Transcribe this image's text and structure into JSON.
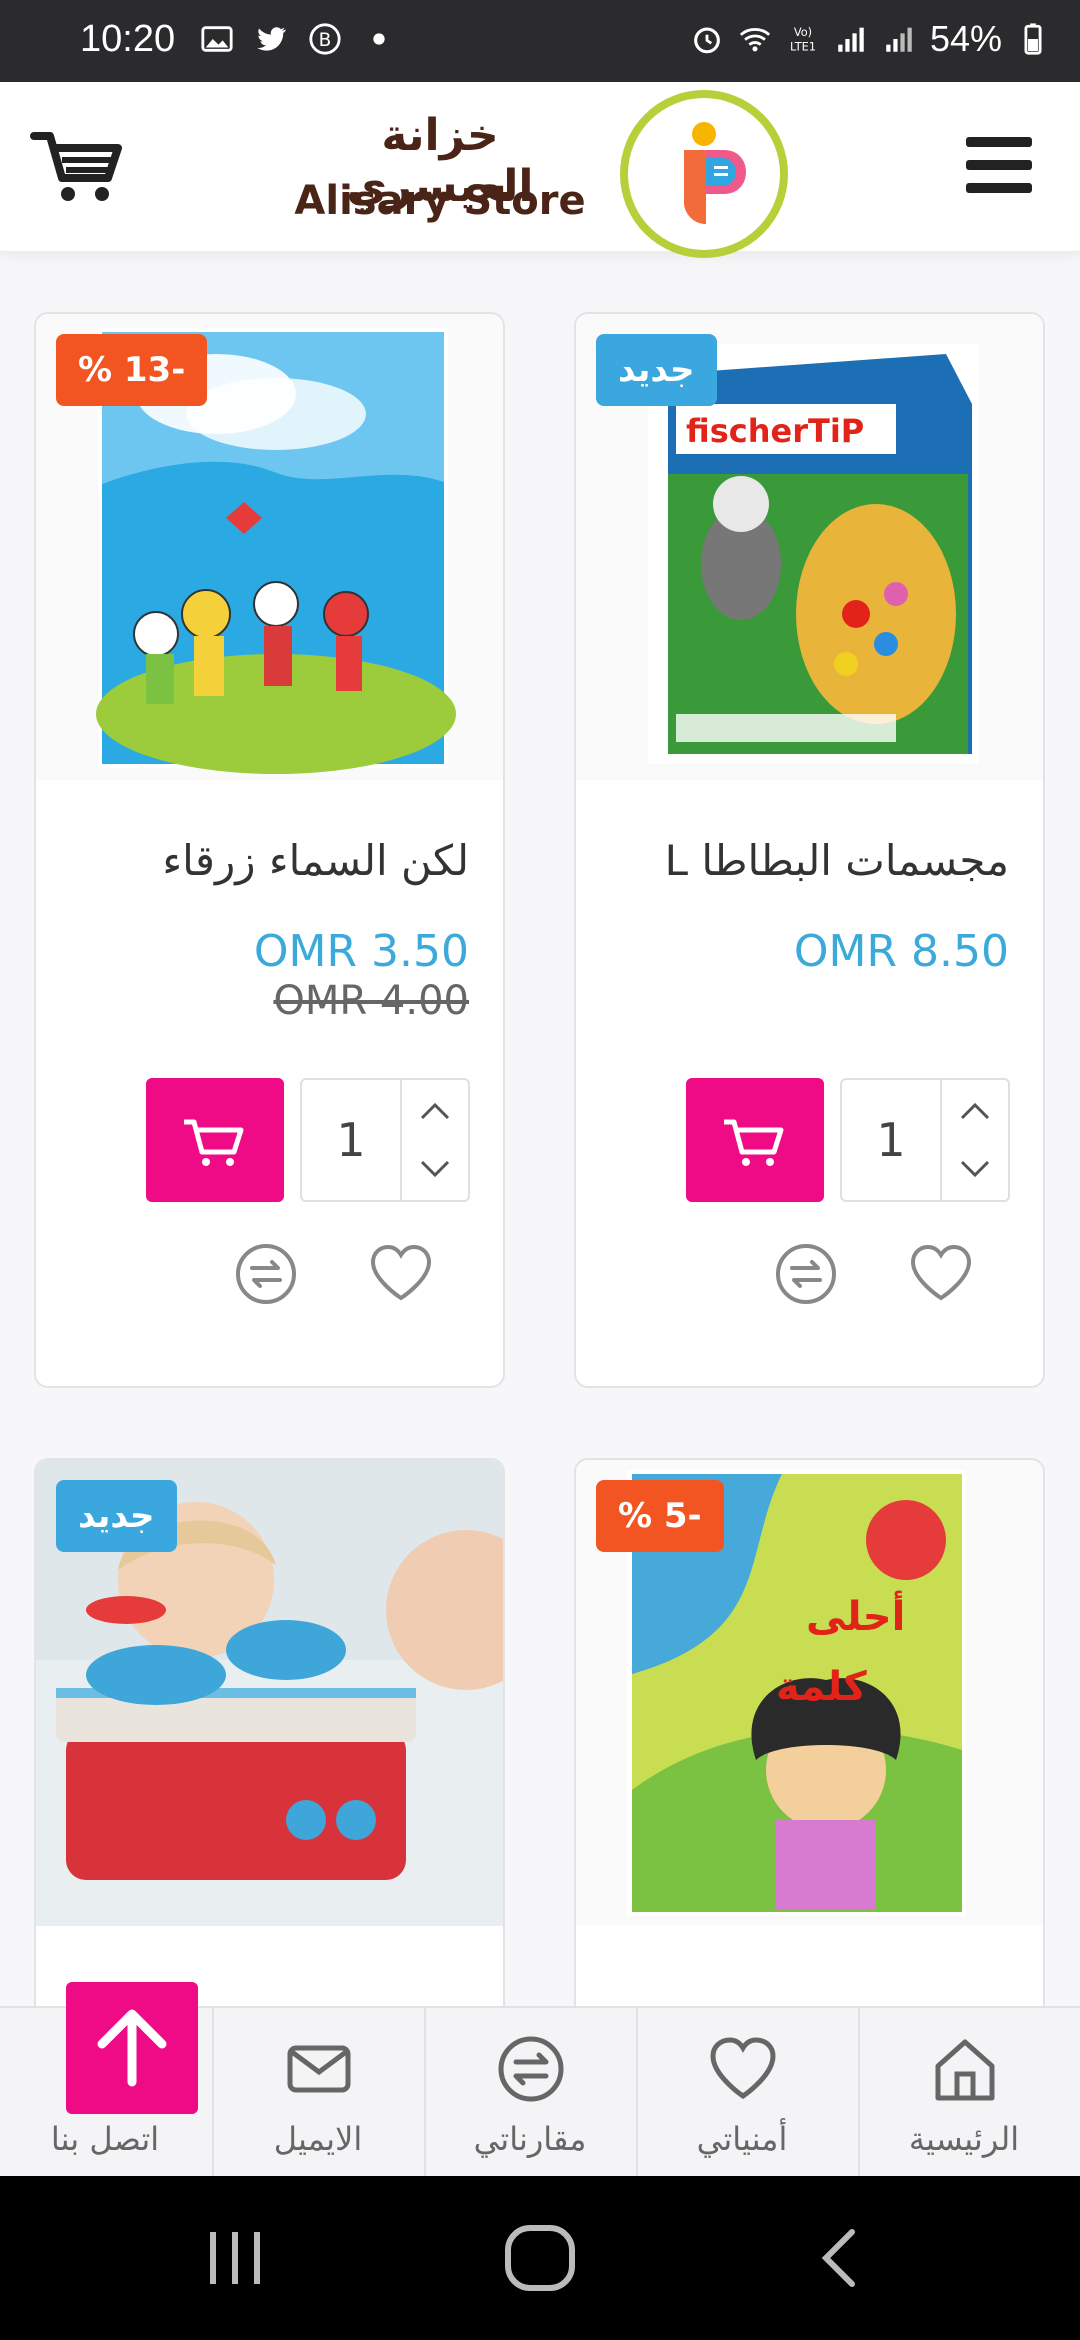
{
  "status_bar": {
    "time": "10:20",
    "battery": "54%",
    "left_icons": [
      "image-icon",
      "twitter-icon",
      "b-icon",
      "dot-icon"
    ],
    "right_icons": [
      "alarm-icon",
      "wifi-icon",
      "volte-icon",
      "signal-icon",
      "signal-icon",
      "battery-icon"
    ]
  },
  "header": {
    "brand_arabic": "خزانة العيسري",
    "brand_english": "Alisary Store",
    "menu_icon": "hamburger-icon",
    "cart_icon": "cart-icon",
    "accent": "#b8cf3a"
  },
  "products": [
    {
      "title": "لكن السماء زرقاء",
      "price": "OMR 3.50",
      "old_price": "OMR 4.00",
      "badge": "% 13-",
      "badge_type": "sale",
      "quantity": "1"
    },
    {
      "title": "مجسمات البطاطا L",
      "price": "OMR 8.50",
      "old_price": "",
      "badge": "جديد",
      "badge_type": "new",
      "quantity": "1"
    },
    {
      "title": "",
      "badge": "جديد",
      "badge_type": "new"
    },
    {
      "title": "",
      "badge": "% 5-",
      "badge_type": "sale"
    }
  ],
  "bottom_nav": {
    "contact_label": "اتصل بنا",
    "email_label": "الايميل",
    "compare_label": "مقارناتي",
    "wishlist_label": "أمنياتي",
    "home_label": "الرئيسية"
  },
  "colors": {
    "price": "#3ba9d9",
    "add_to_cart": "#ef0b86",
    "badge_new": "#3aa7de",
    "badge_sale": "#f25522"
  }
}
